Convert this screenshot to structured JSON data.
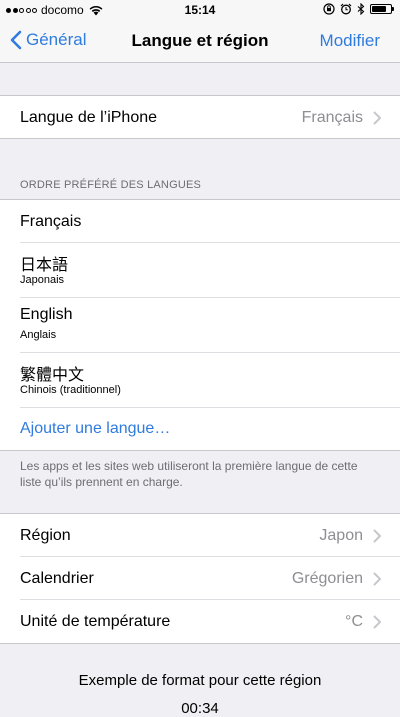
{
  "status_bar": {
    "carrier": "docomo",
    "time": "15:14"
  },
  "nav": {
    "back_label": "Général",
    "title": "Langue et région",
    "action_label": "Modifier"
  },
  "iphone_language": {
    "label": "Langue de l’iPhone",
    "value": "Français"
  },
  "preferred_languages": {
    "header": "ORDRE PRÉFÉRÉ DES LANGUES",
    "items": [
      {
        "name": "Français",
        "subtitle": ""
      },
      {
        "name": "日本語",
        "subtitle": "Japonais"
      },
      {
        "name": "English",
        "subtitle": "Anglais"
      },
      {
        "name": "繁體中文",
        "subtitle": "Chinois (traditionnel)"
      }
    ],
    "add_label": "Ajouter une langue…",
    "footer": "Les apps et les sites web utiliseront la première langue de cette liste qu’ils prennent en charge."
  },
  "settings": {
    "region_label": "Région",
    "region_value": "Japon",
    "calendar_label": "Calendrier",
    "calendar_value": "Grégorien",
    "temperature_label": "Unité de température",
    "temperature_value": "°C"
  },
  "example": {
    "title": "Exemple de format pour cette région",
    "time": "00:34"
  },
  "colors": {
    "accent": "#2f7bde",
    "background": "#efeff4",
    "secondary_text": "#8e8e93"
  }
}
